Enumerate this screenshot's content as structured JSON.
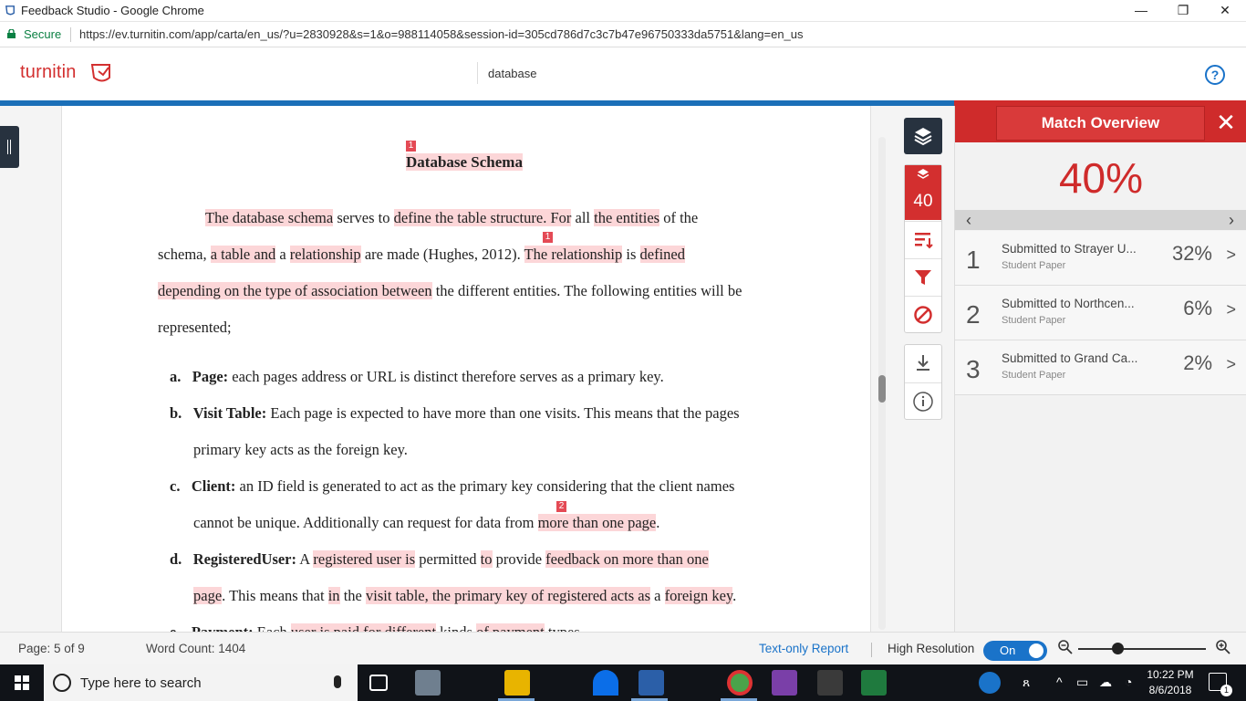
{
  "browser": {
    "window_title": "Feedback Studio - Google Chrome",
    "secure_label": "Secure",
    "url": "https://ev.turnitin.com/app/carta/en_us/?u=2830928&s=1&o=988114058&session-id=305cd786d7c3c7b47e96750333da5751&lang=en_us"
  },
  "header": {
    "logo_text": "turnitin",
    "paper_title": "database",
    "help_label": "?"
  },
  "document": {
    "title": "Database Schema",
    "markers": {
      "m1": "1",
      "m2": "1",
      "m3": "2"
    },
    "p1": {
      "l1_a": "The database schema",
      "l1_b": " serves to ",
      "l1_c": "define the table structure. For",
      "l1_d": " all ",
      "l1_e": "the entities",
      "l1_f": " of the",
      "l2_a": "schema, ",
      "l2_b": "a table and",
      "l2_c": " a ",
      "l2_d": "relationship",
      "l2_e": " are made (Hughes, 2012). ",
      "l2_f": "The relationship",
      "l2_g": " is ",
      "l2_h": "defined",
      "l3_a": "depending on the type of association between",
      "l3_b": " the different entities. The following entities will be",
      "l4": "represented;"
    },
    "items": {
      "a_letter": "a.",
      "a_term": "Page:",
      "a_text": " each pages address or URL is distinct therefore serves as a primary key.",
      "b_letter": "b.",
      "b_term": "Visit Table:",
      "b_text": " Each page is expected to have more than one visits. This means that the pages",
      "b_cont": "primary key acts as the foreign key.",
      "c_letter": "c.",
      "c_term": "Client:",
      "c_text": " an ID field is generated to act as the primary key considering that the client names",
      "c_cont_a": "cannot be unique. Additionally can request for data from ",
      "c_cont_b": "more than one page",
      "c_cont_c": ".",
      "d_letter": "d.",
      "d_term": "RegisteredUser:",
      "d_t1": " A ",
      "d_t2": "registered user is",
      "d_t3": " permitted ",
      "d_t4": "to",
      "d_t5": " provide ",
      "d_t6": "feedback on more than one",
      "d_c1": "page",
      "d_c2": ". This means that ",
      "d_c3": "in",
      "d_c4": " the ",
      "d_c5": "visit table, the primary key of registered acts as",
      "d_c6": " a ",
      "d_c7": "foreign key",
      "d_c8": ".",
      "e_letter": "e.",
      "e_term": "Payment:",
      "e_t1": " Each ",
      "e_t2": "user is paid for different",
      "e_t3": " kinds ",
      "e_t4": "of payment",
      "e_t5": " types"
    }
  },
  "rail": {
    "similarity_score": "40"
  },
  "match_overview": {
    "title": "Match Overview",
    "close": "✕",
    "percent": "40%",
    "prev": "‹",
    "next": "›",
    "matches": [
      {
        "num": "1",
        "source": "Submitted to Strayer U...",
        "type": "Student Paper",
        "percent": "32%"
      },
      {
        "num": "2",
        "source": "Submitted to Northcen...",
        "type": "Student Paper",
        "percent": "6%"
      },
      {
        "num": "3",
        "source": "Submitted to Grand Ca...",
        "type": "Student Paper",
        "percent": "2%"
      }
    ]
  },
  "status": {
    "page": "Page: 5 of 9",
    "word_count": "Word Count: 1404",
    "text_only": "Text-only Report",
    "high_res": "High Resolution",
    "toggle": "On"
  },
  "taskbar": {
    "search_placeholder": "Type here to search",
    "time": "10:22 PM",
    "date": "8/6/2018",
    "notif_count": "1"
  },
  "colors": {
    "brand_red": "#cf2b2b",
    "brand_blue": "#1b6fb8",
    "highlight": "#fcd6d8",
    "marker": "#e44a55"
  }
}
